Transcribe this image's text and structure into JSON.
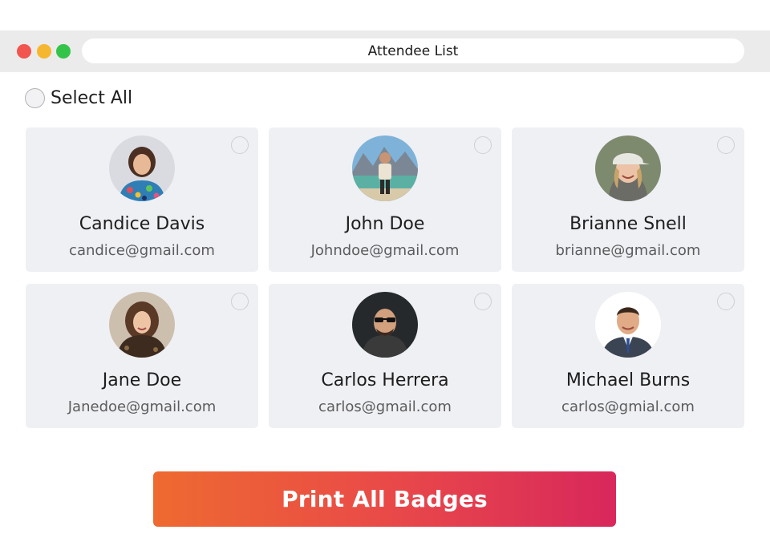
{
  "window": {
    "title": "Attendee List",
    "controls": [
      "close",
      "minimize",
      "maximize"
    ],
    "colors": {
      "close": "#f2544e",
      "minimize": "#f6b730",
      "maximize": "#35c44a"
    }
  },
  "select_all": {
    "label": "Select All",
    "checked": false
  },
  "attendees": [
    {
      "name": "Candice Davis",
      "email": "candice@gmail.com",
      "selected": false
    },
    {
      "name": "John Doe",
      "email": "Johndoe@gmail.com",
      "selected": false
    },
    {
      "name": "Brianne Snell",
      "email": "brianne@gmail.com",
      "selected": false
    },
    {
      "name": "Jane Doe",
      "email": "Janedoe@gmail.com",
      "selected": false
    },
    {
      "name": "Carlos Herrera",
      "email": "carlos@gmail.com",
      "selected": false
    },
    {
      "name": "Michael Burns",
      "email": "carlos@gmial.com",
      "selected": false
    }
  ],
  "print_button": {
    "label": "Print All Badges",
    "gradient": [
      "#ee6a30",
      "#d8275c"
    ]
  }
}
